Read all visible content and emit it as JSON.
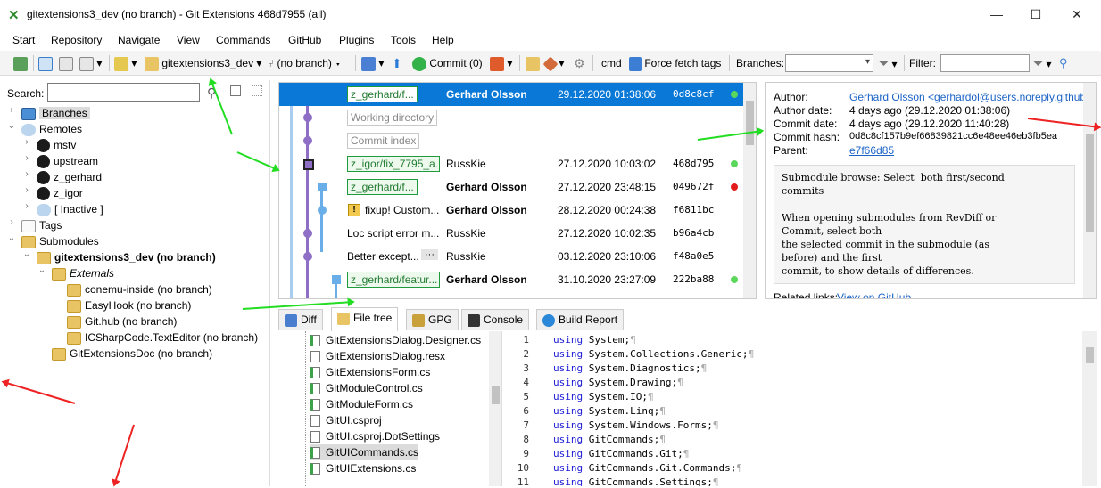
{
  "window": {
    "title": "gitextensions3_dev (no branch) - Git Extensions 468d7955 (all)",
    "minimize": "—",
    "maximize": "☐",
    "close": "✕"
  },
  "menu": [
    "Start",
    "Repository",
    "Navigate",
    "View",
    "Commands",
    "GitHub",
    "Plugins",
    "Tools",
    "Help"
  ],
  "toolbar": {
    "repo": "gitextensions3_dev",
    "branch": "(no branch)",
    "commit": "Commit (0)",
    "cmd": "cmd",
    "force_fetch": "Force fetch tags",
    "branches_label": "Branches:",
    "filter_label": "Filter:"
  },
  "left": {
    "search_label": "Search:",
    "tree": [
      {
        "label": "Branches",
        "icon": "monitor",
        "level": 0,
        "expander": ">",
        "selected": true
      },
      {
        "label": "Remotes",
        "icon": "cloud",
        "level": 0,
        "expander": "v"
      },
      {
        "label": "mstv",
        "icon": "github",
        "level": 1,
        "expander": ">"
      },
      {
        "label": "upstream",
        "icon": "github",
        "level": 1,
        "expander": ">"
      },
      {
        "label": "z_gerhard",
        "icon": "github",
        "level": 1,
        "expander": ">"
      },
      {
        "label": "z_igor",
        "icon": "github",
        "level": 1,
        "expander": ">"
      },
      {
        "label": "[ Inactive ]",
        "icon": "cloud",
        "level": 1,
        "expander": ">"
      },
      {
        "label": "Tags",
        "icon": "tag",
        "level": 0,
        "expander": ">"
      },
      {
        "label": "Submodules",
        "icon": "folder",
        "level": 0,
        "expander": "v"
      },
      {
        "label": "gitextensions3_dev (no branch)",
        "icon": "folder",
        "level": 1,
        "expander": "v",
        "bold": true
      },
      {
        "label": "Externals",
        "icon": "folder",
        "level": 2,
        "expander": "v",
        "italic": true
      },
      {
        "label": "conemu-inside (no branch)",
        "icon": "folder",
        "level": 3
      },
      {
        "label": "EasyHook (no branch)",
        "icon": "folder",
        "level": 3
      },
      {
        "label": "Git.hub (no branch)",
        "icon": "folder",
        "level": 3
      },
      {
        "label": "ICSharpCode.TextEditor (no branch)",
        "icon": "folder",
        "level": 3
      },
      {
        "label": "GitExtensionsDoc (no branch)",
        "icon": "folder",
        "level": 2
      }
    ]
  },
  "revisions": [
    {
      "tag": "z_gerhard/f...",
      "author": "Gerhard Olsson",
      "bold": true,
      "date": "29.12.2020 01:38:06",
      "hash": "0d8c8cf",
      "dot": "green",
      "selected": true
    },
    {
      "virtual": "Working directory"
    },
    {
      "virtual": "Commit index"
    },
    {
      "tag": "z_igor/fix_7795_a...",
      "author": "RussKie",
      "date": "27.12.2020 10:03:02",
      "hash": "468d795",
      "dot": "green"
    },
    {
      "tag": "z_gerhard/f...",
      "author": "Gerhard Olsson",
      "bold": true,
      "date": "27.12.2020 23:48:15",
      "hash": "049672f",
      "dot": "red"
    },
    {
      "subject": "fixup! Custom...",
      "warn": true,
      "author": "Gerhard Olsson",
      "bold": true,
      "date": "28.12.2020 00:24:38",
      "hash": "f6811bc"
    },
    {
      "subject": "Loc script error m...",
      "author": "RussKie",
      "date": "27.12.2020 10:02:35",
      "hash": "b96a4cb"
    },
    {
      "subject": "Better except...",
      "more": "···",
      "author": "RussKie",
      "date": "03.12.2020 23:10:06",
      "hash": "f48a0e5"
    },
    {
      "tag": "z_gerhard/featur...",
      "author": "Gerhard Olsson",
      "bold": true,
      "date": "31.10.2020 23:27:09",
      "hash": "222ba88",
      "dot": "green"
    }
  ],
  "details": {
    "author_label": "Author:",
    "author": "Gerhard Olsson <gerhardol@users.noreply.github.com>",
    "author_date_label": "Author date:",
    "author_date": "4 days ago (29.12.2020 01:38:06)",
    "commit_date_label": "Commit date:",
    "commit_date": "4 days ago (29.12.2020 11:40:28)",
    "hash_label": "Commit hash:",
    "hash": "0d8c8cf157b9ef66839821cc6e48ee46eb3fb5ea",
    "parent_label": "Parent:",
    "parent": "e7f66d85",
    "message": "Submodule browse: Select  both first/second\ncommits\n\nWhen opening submodules from RevDiff or\nCommit, select both\nthe selected commit in the submodule (as\nbefore) and the first\ncommit, to show details of differences.",
    "related_label": "Related links:",
    "related": "View on GitHub"
  },
  "tabs": [
    "Diff",
    "File tree",
    "GPG",
    "Console",
    "Build Report"
  ],
  "files": [
    "GitExtensionsDialog.Designer.cs",
    "GitExtensionsDialog.resx",
    "GitExtensionsForm.cs",
    "GitModuleControl.cs",
    "GitModuleForm.cs",
    "GitUI.csproj",
    "GitUI.csproj.DotSettings",
    "GitUICommands.cs",
    "GitUIExtensions.cs"
  ],
  "code": [
    {
      "n": "1",
      "kw": "using",
      "rest": " System;"
    },
    {
      "n": "2",
      "kw": "using",
      "rest": " System.Collections.Generic;"
    },
    {
      "n": "3",
      "kw": "using",
      "rest": " System.Diagnostics;"
    },
    {
      "n": "4",
      "kw": "using",
      "rest": " System.Drawing;"
    },
    {
      "n": "5",
      "kw": "using",
      "rest": " System.IO;"
    },
    {
      "n": "6",
      "kw": "using",
      "rest": " System.Linq;"
    },
    {
      "n": "7",
      "kw": "using",
      "rest": " System.Windows.Forms;"
    },
    {
      "n": "8",
      "kw": "using",
      "rest": " GitCommands;"
    },
    {
      "n": "9",
      "kw": "using",
      "rest": " GitCommands.Git;"
    },
    {
      "n": "10",
      "kw": "using",
      "rest": " GitCommands.Git.Commands;"
    },
    {
      "n": "11",
      "kw": "using",
      "rest": " GitCommands.Settings;"
    }
  ],
  "colors": {
    "accent": "#0a78d7",
    "tag_green": "#1f9a3d",
    "graph_purple": "#8f6fc6",
    "graph_blue": "#6aaee9",
    "annot_green": "#22dd22",
    "annot_red": "#ee2222"
  }
}
